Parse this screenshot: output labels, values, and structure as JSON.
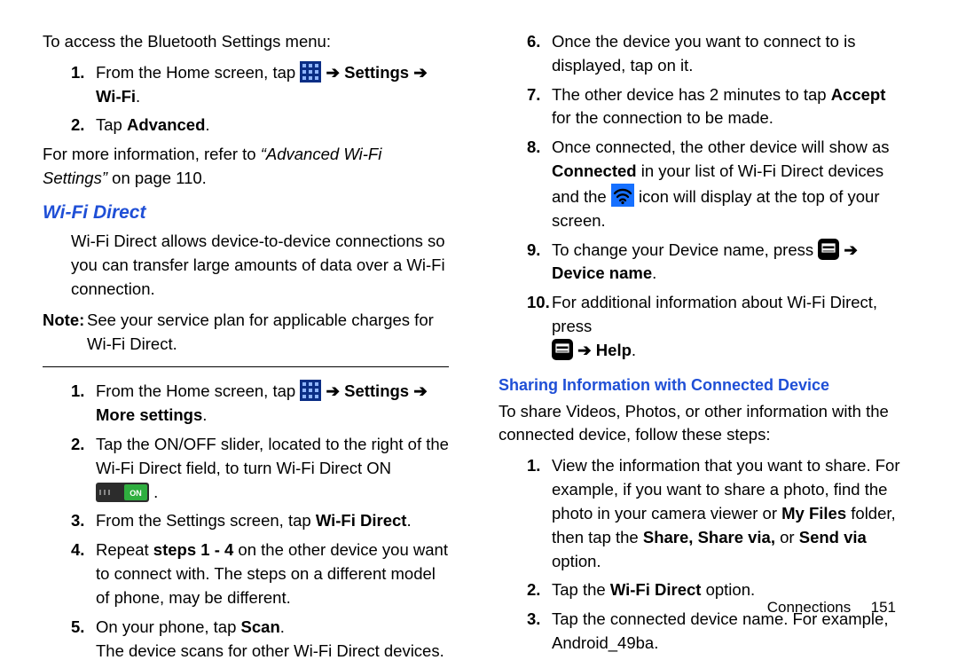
{
  "arrow": "➔",
  "left": {
    "intro": "To access the Bluetooth Settings menu:",
    "l1_part1": "From the Home screen, tap ",
    "l1_part2": " Settings ",
    "l1_part3": " Wi-Fi",
    "l2a": "Tap ",
    "l2b": "Advanced",
    "after1": "For more information, refer to ",
    "after1_ital": "“Advanced Wi-Fi Settings” ",
    "after1_tail": " on page 110.",
    "h_wifi": "Wi-Fi Direct",
    "wifi_desc": "Wi-Fi Direct allows device-to-device connections so you can transfer large amounts of data over a Wi-Fi connection.",
    "note_label": "Note:",
    "note_body": "See your service plan for applicable charges for Wi-Fi Direct.",
    "s1a": "From the Home screen, tap ",
    "s1b": " Settings ",
    "s1c": " More settings",
    "s2a": "Tap the ON/OFF slider, located to the right of the Wi-Fi Direct field, to turn Wi-Fi Direct ON ",
    "s3a": "From the Settings screen, tap ",
    "s3b": "Wi-Fi Direct",
    "s4a": "Repeat ",
    "s4b": "steps 1 - 4",
    "s4c": " on the other device you want to connect with. The steps on a different model of phone, may be different.",
    "s5a": "On your phone, tap ",
    "s5b": "Scan",
    "s5c": "The device scans for other Wi-Fi Direct devices."
  },
  "right": {
    "s6": "Once the device you want to connect to is displayed, tap on it.",
    "s7a": "The other device has 2 minutes to tap ",
    "s7b": "Accept",
    "s7c": " for the connection to be made.",
    "s8a": "Once connected, the other device will show as ",
    "s8b": "Connected",
    "s8c": " in your list of Wi-Fi Direct devices and the ",
    "s8d": " icon will display at the top of your screen.",
    "s9a": "To change your Device name, press ",
    "s9b": " Device name",
    "s10a": "For additional information about Wi-Fi Direct, press ",
    "s10b": " Help",
    "h_share": "Sharing Information with Connected Device",
    "share_intro": "To share Videos, Photos, or other information with the connected device, follow these steps:",
    "sh1a": "View the information that you want to share. For example, if you want to share a photo, find the photo in your camera viewer or ",
    "sh1b": "My Files",
    "sh1c": " folder, then tap the ",
    "sh1d": "Share, Share via,",
    "sh1e": " or ",
    "sh1f": "Send via",
    "sh1g": " option.",
    "sh2a": "Tap the ",
    "sh2b": "Wi-Fi Direct",
    "sh2c": " option.",
    "sh3": "Tap the connected device name. For example, Android_49ba."
  },
  "footer": {
    "section": "Connections",
    "page": "151"
  }
}
